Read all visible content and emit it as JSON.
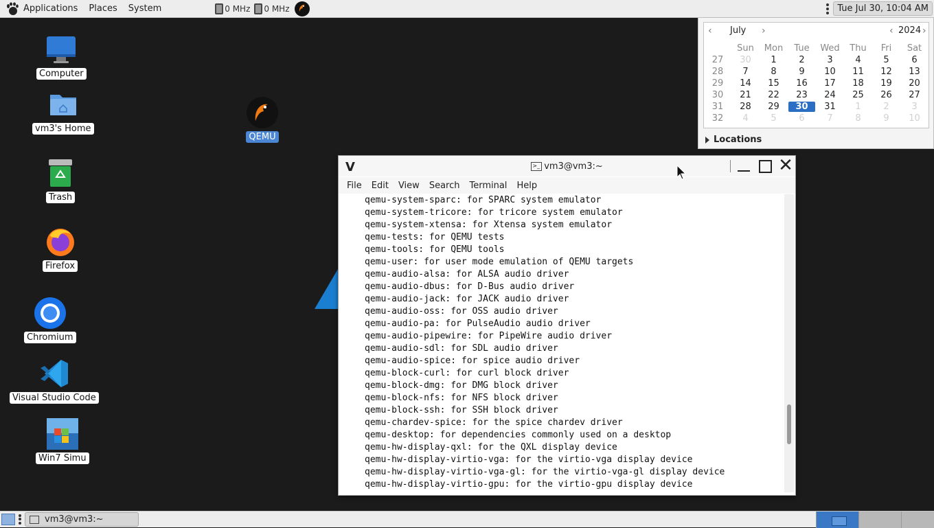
{
  "top_panel": {
    "applications": "Applications",
    "places": "Places",
    "system": "System",
    "cpu1": "0 MHz",
    "cpu2": "0 MHz",
    "clock": "Tue Jul 30, 10:04 AM"
  },
  "desktop": {
    "icons": [
      {
        "label": "Computer",
        "icon": "computer-icon"
      },
      {
        "label": "vm3's Home",
        "icon": "home-folder-icon"
      },
      {
        "label": "Trash",
        "icon": "trash-icon"
      },
      {
        "label": "Firefox",
        "icon": "firefox-icon"
      },
      {
        "label": "Chromium",
        "icon": "chromium-icon"
      },
      {
        "label": "Visual Studio Code",
        "icon": "vscode-icon"
      },
      {
        "label": "Win7 Simu",
        "icon": "win7-icon"
      },
      {
        "label": "QEMU",
        "icon": "qemu-icon"
      }
    ]
  },
  "calendar": {
    "month": "July",
    "year": "2024",
    "prev": "‹",
    "next": "›",
    "weekday_headers": [
      "Sun",
      "Mon",
      "Tue",
      "Wed",
      "Thu",
      "Fri",
      "Sat"
    ],
    "rows": [
      {
        "week": "27",
        "days": [
          "30",
          "1",
          "2",
          "3",
          "4",
          "5",
          "6"
        ]
      },
      {
        "week": "28",
        "days": [
          "7",
          "8",
          "9",
          "10",
          "11",
          "12",
          "13"
        ]
      },
      {
        "week": "29",
        "days": [
          "14",
          "15",
          "16",
          "17",
          "18",
          "19",
          "20"
        ]
      },
      {
        "week": "30",
        "days": [
          "21",
          "22",
          "23",
          "24",
          "25",
          "26",
          "27"
        ]
      },
      {
        "week": "31",
        "days": [
          "28",
          "29",
          "30",
          "31",
          "1",
          "2",
          "3"
        ]
      },
      {
        "week": "32",
        "days": [
          "4",
          "5",
          "6",
          "7",
          "8",
          "9",
          "10"
        ]
      }
    ],
    "today": "30",
    "locations": "Locations"
  },
  "terminal": {
    "title": "vm3@vm3:~",
    "menu": [
      "File",
      "Edit",
      "View",
      "Search",
      "Terminal",
      "Help"
    ],
    "lines": [
      "qemu-system-sparc: for SPARC system emulator",
      "qemu-system-tricore: for tricore system emulator",
      "qemu-system-xtensa: for Xtensa system emulator",
      "qemu-tests: for QEMU tests",
      "qemu-tools: for QEMU tools",
      "qemu-user: for user mode emulation of QEMU targets",
      "qemu-audio-alsa: for ALSA audio driver",
      "qemu-audio-dbus: for D-Bus audio driver",
      "qemu-audio-jack: for JACK audio driver",
      "qemu-audio-oss: for OSS audio driver",
      "qemu-audio-pa: for PulseAudio audio driver",
      "qemu-audio-pipewire: for PipeWire audio driver",
      "qemu-audio-sdl: for SDL audio driver",
      "qemu-audio-spice: for spice audio driver",
      "qemu-block-curl: for curl block driver",
      "qemu-block-dmg: for DMG block driver",
      "qemu-block-nfs: for NFS block driver",
      "qemu-block-ssh: for SSH block driver",
      "qemu-chardev-spice: for the spice chardev driver",
      "qemu-desktop: for dependencies commonly used on a desktop",
      "qemu-hw-display-qxl: for the QXL display device",
      "qemu-hw-display-virtio-vga: for the virtio-vga display device",
      "qemu-hw-display-virtio-vga-gl: for the virtio-vga-gl display device",
      "qemu-hw-display-virtio-gpu: for the virtio-gpu display device"
    ]
  },
  "bottom_panel": {
    "task": "vm3@vm3:~",
    "workspaces": 4,
    "active_workspace": 1
  },
  "colors": {
    "accent": "#2b6fc4",
    "desktop_bg": "#1b1b1b"
  }
}
